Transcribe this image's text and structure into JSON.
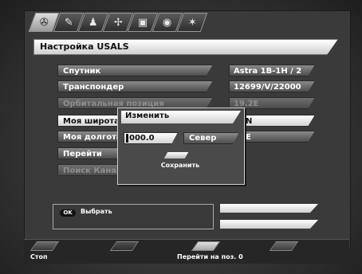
{
  "icon_tabs": [
    {
      "name": "satellite-dish-icon",
      "glyph": "✇"
    },
    {
      "name": "tools-icon",
      "glyph": "✎"
    },
    {
      "name": "person-icon",
      "glyph": "♟"
    },
    {
      "name": "antenna-icon",
      "glyph": "✢"
    },
    {
      "name": "tv-icon",
      "glyph": "▣"
    },
    {
      "name": "disc-icon",
      "glyph": "◉"
    },
    {
      "name": "network-icon",
      "glyph": "✶"
    }
  ],
  "header": {
    "title": "Настройка USALS"
  },
  "rows": [
    {
      "label": "Спутник",
      "value": "Astra 1B-1H / 2"
    },
    {
      "label": "Транспондер",
      "value": "12699/V/22000"
    },
    {
      "label": "Орбитальная позиция",
      "value": "19.2E"
    },
    {
      "label": "Моя широта",
      "value": "N"
    },
    {
      "label": "Моя долгота",
      "value": "E"
    },
    {
      "label": "Перейти",
      "value": ""
    },
    {
      "label": "Поиск Канала",
      "value": ""
    }
  ],
  "popup": {
    "title": "Изменить",
    "value_field": "000.0",
    "direction": "Север",
    "save_label": "Сохранить"
  },
  "info": {
    "ok_badge": "OK",
    "ok_label": "Выбрать"
  },
  "bottom": {
    "stop_label": "Стоп",
    "goto_label": "Перейти на поз. 0"
  },
  "colors": {
    "background": "#353535",
    "highlight": "#ffffff"
  }
}
